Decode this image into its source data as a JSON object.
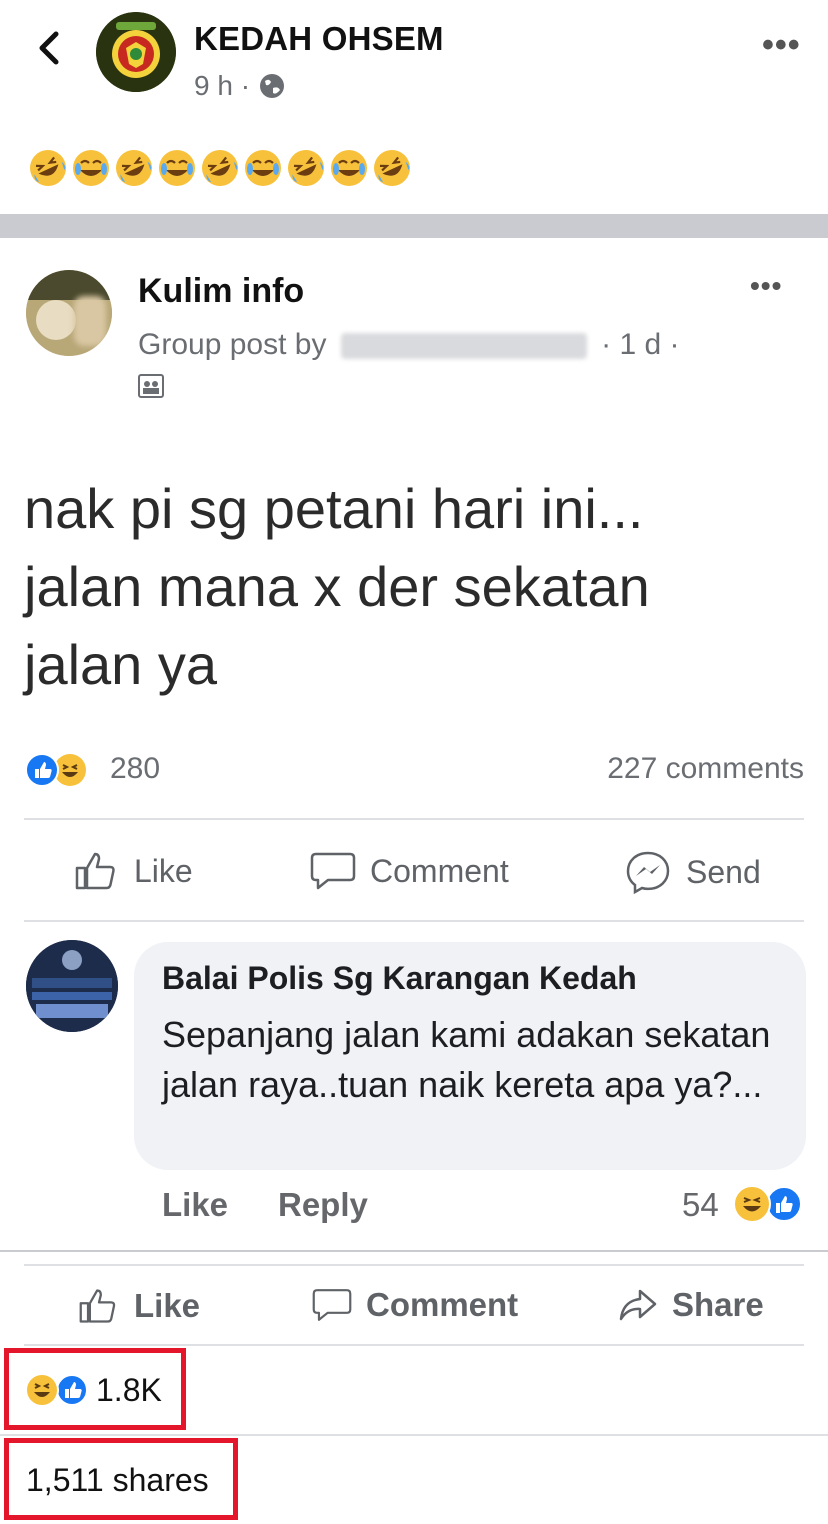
{
  "header": {
    "page_name": "KEDAH OHSEM",
    "time": "9 h",
    "separator": "·"
  },
  "caption_emojis": [
    "rofl",
    "joy",
    "rofl",
    "joy",
    "rofl",
    "joy",
    "rofl",
    "joy",
    "rofl"
  ],
  "shared_post": {
    "group_name": "Kulim info",
    "meta_prefix": "Group post by",
    "meta_suffix": "· 1 d ·",
    "text_lines": [
      "nak pi sg petani hari ini...",
      "jalan mana x der sekatan",
      "jalan ya"
    ],
    "reaction_count": "280",
    "comments_count": "227 comments",
    "actions": {
      "like": "Like",
      "comment": "Comment",
      "send": "Send"
    }
  },
  "comment": {
    "author": "Balai Polis Sg Karangan Kedah",
    "text": "Sepanjang jalan kami adakan sekatan jalan raya..tuan naik kereta apa ya?...",
    "like": "Like",
    "reply": "Reply",
    "reaction_count": "54"
  },
  "main_actions": {
    "like": "Like",
    "comment": "Comment",
    "share": "Share"
  },
  "main_stats": {
    "reactions": "1.8K",
    "shares": "1,511 shares"
  },
  "colors": {
    "highlight_box": "#e3162b",
    "like_blue": "#1877f2",
    "haha_yellow": "#f7c13c"
  }
}
